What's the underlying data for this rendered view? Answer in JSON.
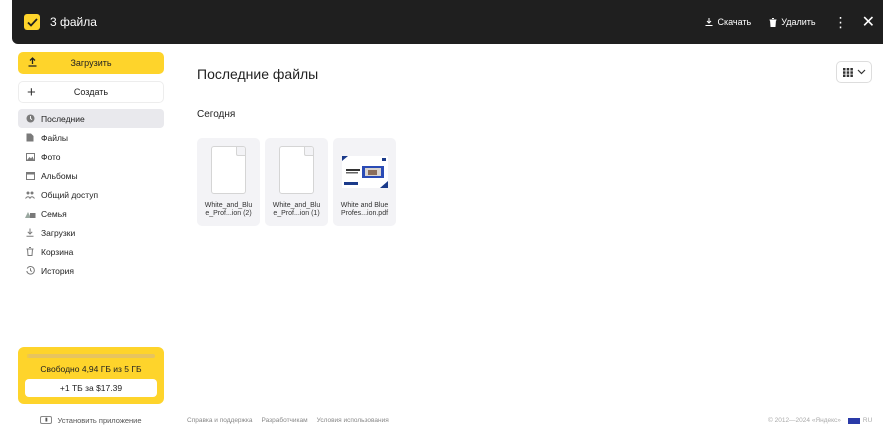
{
  "topbar": {
    "title": "3 файла",
    "download_label": "Скачать",
    "delete_label": "Удалить",
    "more_glyph": "⋮",
    "close_glyph": "✕",
    "accent": "#fed42b"
  },
  "sidebar": {
    "upload_label": "Загрузить",
    "create_label": "Создать",
    "items": [
      {
        "label": "Последние",
        "icon": "clock-icon",
        "active": true
      },
      {
        "label": "Файлы",
        "icon": "file-icon"
      },
      {
        "label": "Фото",
        "icon": "photo-icon"
      },
      {
        "label": "Альбомы",
        "icon": "albums-icon"
      },
      {
        "label": "Общий доступ",
        "icon": "shared-icon"
      },
      {
        "label": "Семья",
        "icon": "family-icon"
      },
      {
        "label": "Загрузки",
        "icon": "downloads-icon"
      },
      {
        "label": "Корзина",
        "icon": "trash-icon"
      },
      {
        "label": "История",
        "icon": "history-icon"
      }
    ],
    "storage": {
      "text": "Свободно 4,94 ГБ из 5 ГБ",
      "used_fraction": 0.012,
      "upgrade_label": "+1 ТБ за $17.39"
    },
    "install_label": "Установить приложение"
  },
  "main": {
    "title": "Последние файлы",
    "section": "Сегодня",
    "files": [
      {
        "name": "White_and_Blu\ne_Prof...ion (2)",
        "type": "doc"
      },
      {
        "name": "White_and_Blu\ne_Prof...ion (1)",
        "type": "doc"
      },
      {
        "name": "White and Blue\nProfes...ion.pdf",
        "type": "pdf"
      }
    ]
  },
  "footer": {
    "links": [
      "Справка и поддержка",
      "Разработчикам",
      "Условия использования"
    ],
    "copyright": "© 2012—2024 «Яндекс»",
    "lang": "RU"
  }
}
